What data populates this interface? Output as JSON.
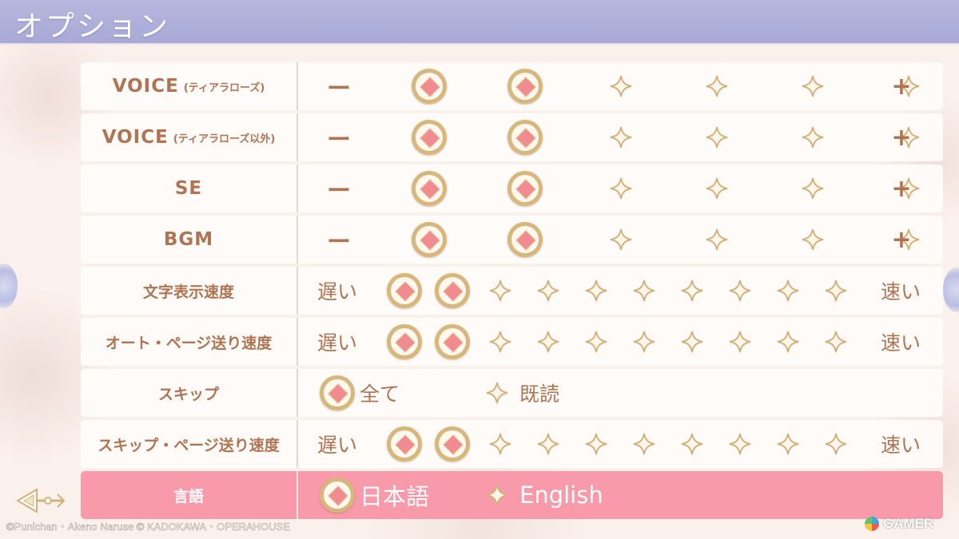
{
  "header": {
    "title": "オプション"
  },
  "colors": {
    "header": "#b0b0da",
    "label_text": "#b17453",
    "highlight_row": "#f89aa9",
    "gem_gold": "#d8b77c",
    "gem_core": "#f08b92"
  },
  "rows": [
    {
      "label": "VOICE",
      "sub": "(ティアラローズ)",
      "type": "volume",
      "min": "ー",
      "max": "+",
      "steps": 6,
      "level": 2
    },
    {
      "label": "VOICE",
      "sub": "(ティアラローズ以外)",
      "type": "volume",
      "min": "ー",
      "max": "+",
      "steps": 6,
      "level": 2
    },
    {
      "label": "SE",
      "sub": "",
      "type": "volume",
      "min": "ー",
      "max": "+",
      "steps": 6,
      "level": 2
    },
    {
      "label": "BGM",
      "sub": "",
      "type": "volume",
      "min": "ー",
      "max": "+",
      "steps": 6,
      "level": 2
    },
    {
      "label": "文字表示速度",
      "sub": "",
      "type": "speed",
      "min": "遅い",
      "max": "速い",
      "steps": 10,
      "level": 2
    },
    {
      "label": "オート・ページ送り速度",
      "sub": "",
      "type": "speed",
      "min": "遅い",
      "max": "速い",
      "steps": 10,
      "level": 2
    },
    {
      "label": "スキップ",
      "sub": "",
      "type": "choice",
      "options": [
        "全て",
        "既読"
      ],
      "selected": 0
    },
    {
      "label": "スキップ・ページ送り速度",
      "sub": "",
      "type": "speed",
      "min": "遅い",
      "max": "速い",
      "steps": 10,
      "level": 2
    },
    {
      "label": "言語",
      "sub": "",
      "type": "choice",
      "options": [
        "日本語",
        "English"
      ],
      "selected": 0,
      "highlight": true
    }
  ],
  "footer": {
    "back_icon": "back-arrow-icon",
    "copyright": "©Punichan・Akeno Naruse © KADOKAWA・OPERAHOUSE",
    "watermark": "GAMER"
  }
}
